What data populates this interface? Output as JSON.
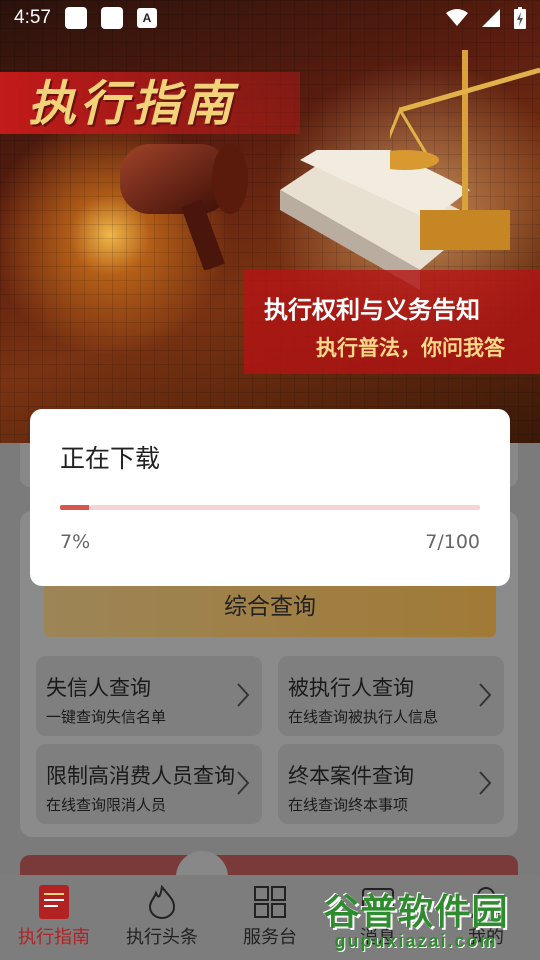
{
  "status_bar": {
    "time": "4:57",
    "icons": [
      "app-square-icon",
      "app-square-icon",
      "a-badge-icon",
      "wifi-icon",
      "signal-icon",
      "battery-charging-icon"
    ],
    "badge_letter": "A"
  },
  "banner": {
    "title": "执行指南",
    "subtitle": "执行权利与义务告知",
    "tagline": "执行普法，你问我答"
  },
  "query": {
    "main_button": "综合查询",
    "items": [
      {
        "title": "失信人查询",
        "subtitle": "一键查询失信名单"
      },
      {
        "title": "被执行人查询",
        "subtitle": "在线查询被执行人信息"
      },
      {
        "title": "限制高消费人员查询",
        "subtitle": "在线查询限消人员"
      },
      {
        "title": "终本案件查询",
        "subtitle": "在线查询终本事项"
      }
    ]
  },
  "dialog": {
    "title": "正在下载",
    "percent_text": "7%",
    "count_text": "7/100",
    "progress": 0.07,
    "progress_color": "#d9534f"
  },
  "tabs": [
    {
      "label": "执行指南",
      "icon": "guide-book-icon",
      "active": true
    },
    {
      "label": "执行头条",
      "icon": "flame-icon",
      "active": false
    },
    {
      "label": "服务台",
      "icon": "grid-icon",
      "active": false
    },
    {
      "label": "消息",
      "icon": "message-icon",
      "active": false
    },
    {
      "label": "我的",
      "icon": "profile-icon",
      "active": false
    }
  ],
  "watermark": {
    "name": "谷普软件园",
    "url": "gupuxiazai.com"
  },
  "colors": {
    "accent": "#b22222",
    "banner_red": "#c41a1a",
    "gold": "#f3d37a"
  }
}
